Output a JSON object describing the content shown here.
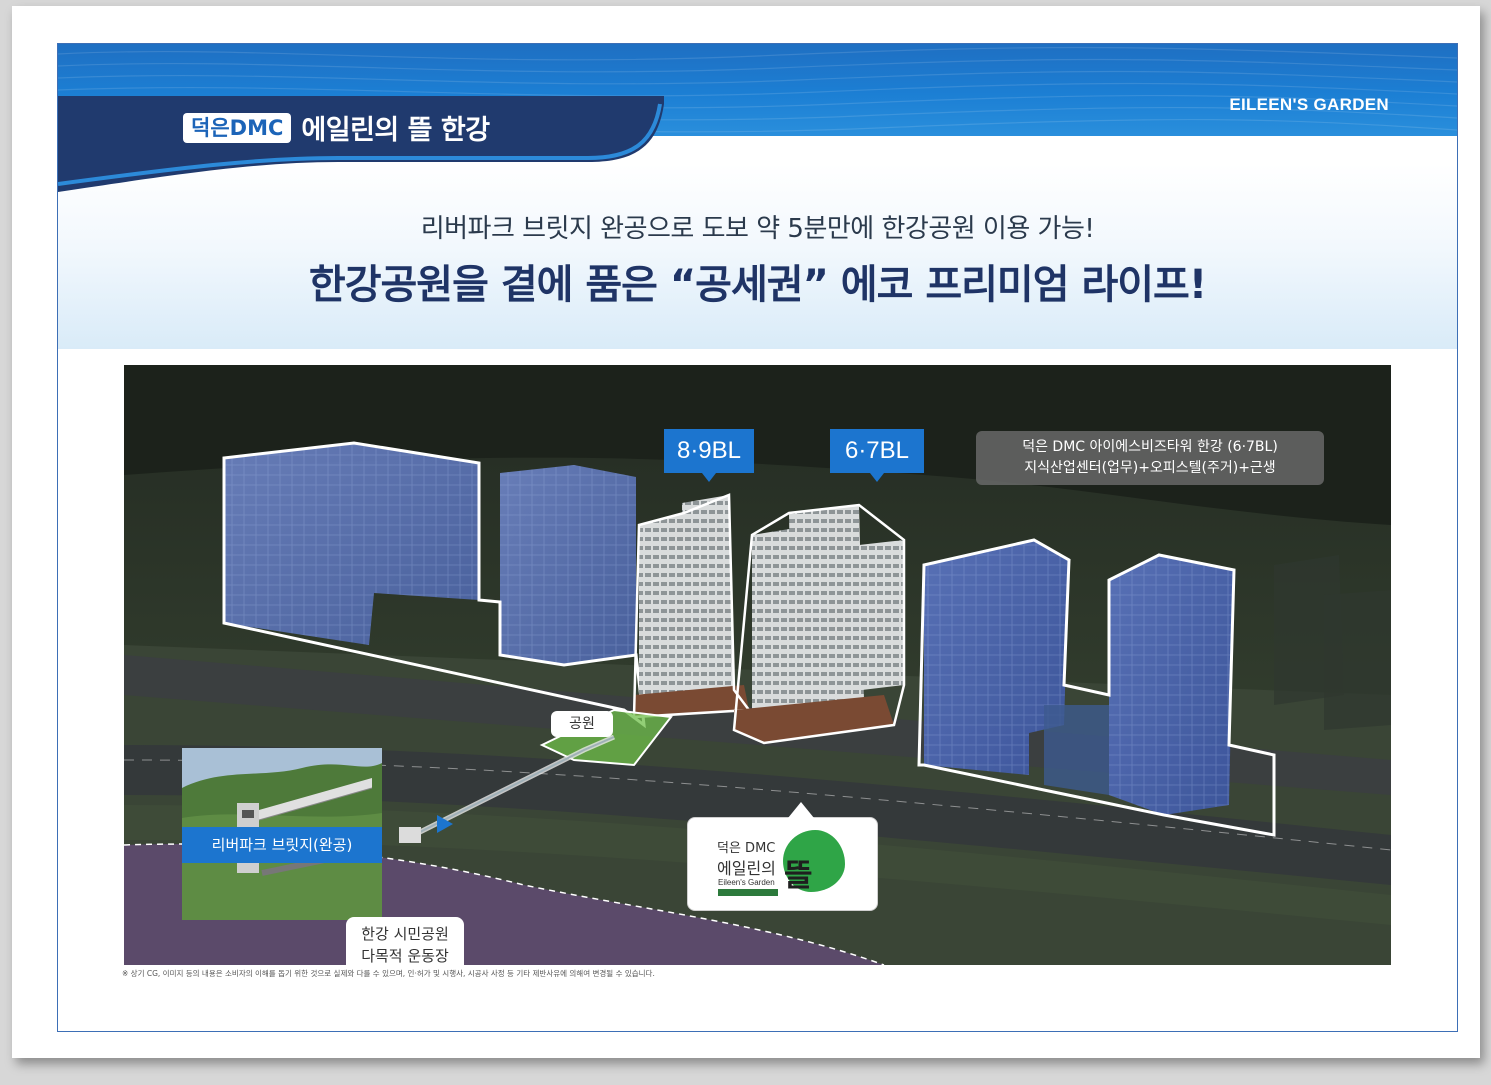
{
  "header": {
    "tag": "덕은DMC",
    "title": "에일린의 뜰 한강",
    "brand": "EILEEN'S GARDEN"
  },
  "headline": {
    "sub": "리버파크 브릿지 완공으로 도보 약 5분만에 한강공원 이용 가능!",
    "main": "한강공원을 곁에 품은 “공세권” 에코 프리미엄 라이프!"
  },
  "map": {
    "block_a": "8·9BL",
    "block_b": "6·7BL",
    "info_line1": "덕은 DMC 아이에스비즈타워 한강 (6·7BL)",
    "info_line2": "지식산업센터(업무)+오피스텔(주거)+근생",
    "park": "공원",
    "bridge_caption": "리버파크 브릿지(완공)",
    "sports_line1": "한강 시민공원",
    "sports_line2": "다목적 운동장",
    "logo_small": "덕은 DMC",
    "logo_name": "에일린의",
    "logo_big": "뜰",
    "logo_en": "Eileen's Garden"
  },
  "disclaimer": "※ 상기 CG, 이미지 등의 내용은 소비자의 이해를 돕기 위한 것으로 실제와 다를 수 있으며, 인·허가 및 시행사, 시공사 사정 등 기타 제반사유에 의해여 변경될 수 있습니다.",
  "colors": {
    "primary_blue": "#1c75cf",
    "navy": "#1f3466",
    "green": "#2fa547"
  }
}
